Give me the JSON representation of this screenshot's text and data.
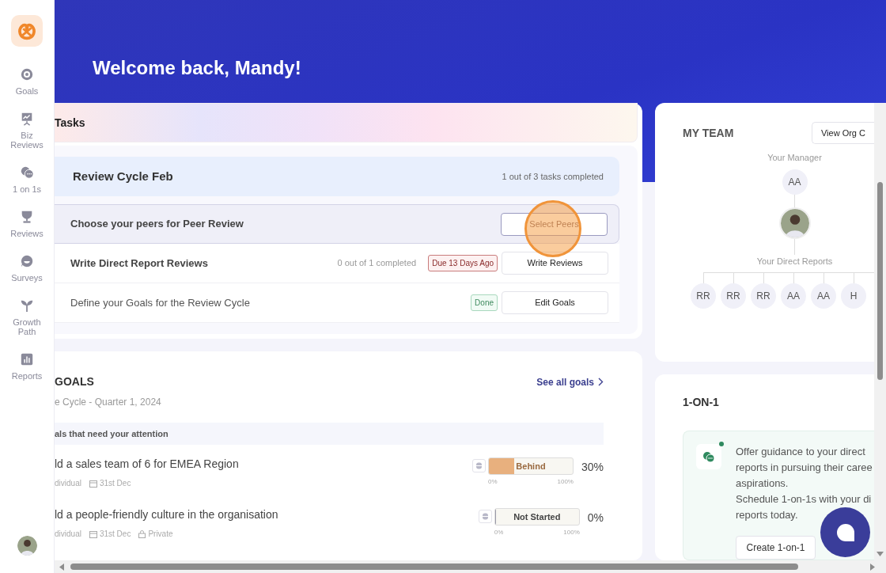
{
  "sidebar": {
    "items": [
      {
        "label": "Goals",
        "selected": false
      },
      {
        "label": "Biz Reviews",
        "selected": false
      },
      {
        "label": "1 on 1s",
        "selected": false
      },
      {
        "label": "Reviews",
        "selected": false
      },
      {
        "label": "Surveys",
        "selected": false
      },
      {
        "label": "Growth Path",
        "selected": false
      },
      {
        "label": "Reports",
        "selected": false
      }
    ]
  },
  "welcome": "Welcome back, Mandy!",
  "tasks": {
    "title": "Tasks",
    "cycle": {
      "name": "Review Cycle Feb",
      "progress": "1 out of 3 tasks completed"
    },
    "rows": [
      {
        "label": "Choose your peers for Peer Review",
        "selected": true,
        "action": "Select Peers"
      },
      {
        "label": "Write Direct Report Reviews",
        "selected": false,
        "progress": "0 out of 1 completed",
        "badge": {
          "kind": "due",
          "text": "Due 13 Days Ago"
        },
        "action": "Write Reviews"
      },
      {
        "label": "Define your Goals for the Review Cycle",
        "selected": false,
        "badge": {
          "kind": "done",
          "text": "Done"
        },
        "action": "Edit Goals"
      }
    ]
  },
  "goals": {
    "title": "GOALS",
    "subtitle": "e Cycle - Quarter 1, 2024",
    "link": "See all goals",
    "section": "als that need your attention",
    "rows": [
      {
        "title": "ld a sales team of 6 for EMEA Region",
        "type": "dividual",
        "date": "31st Dec",
        "private": null,
        "status": "Behind",
        "kind": "behind",
        "level": 0.3,
        "percent": "30%",
        "min": "0%",
        "max": "100%"
      },
      {
        "title": "ld a people-friendly culture in the organisation",
        "type": "dividual",
        "date": "31st Dec",
        "private": "Private",
        "status": "Not Started",
        "kind": "not_started",
        "level": 0,
        "percent": "0%",
        "min": "0%",
        "max": "100%"
      }
    ]
  },
  "my_team": {
    "title": "MY TEAM",
    "button": "View Org C",
    "manager_label": "Your Manager",
    "manager": "AA",
    "reports_label": "Your Direct Reports",
    "reports": [
      "RR",
      "RR",
      "RR",
      "AA",
      "AA",
      "H"
    ]
  },
  "one_on_one": {
    "title": "1-ON-1",
    "lines": [
      "Offer guidance to your direct",
      "reports in pursuing their caree",
      "aspirations.",
      "Schedule 1-on-1s with your di",
      "reports today."
    ],
    "button": "Create 1-on-1"
  }
}
